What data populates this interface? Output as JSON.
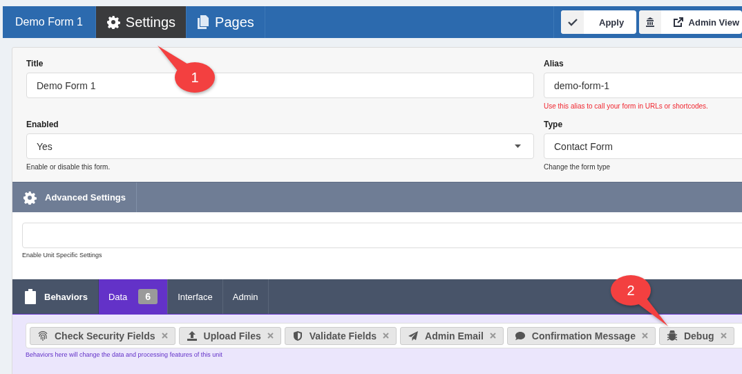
{
  "header": {
    "title": "Demo Form 1",
    "tabs": [
      {
        "label": "Settings",
        "selected": true
      },
      {
        "label": "Pages",
        "selected": false
      }
    ],
    "buttons": [
      {
        "label": "Apply"
      },
      {
        "label": "Admin View"
      }
    ]
  },
  "fields": [
    {
      "label": "Title",
      "kind": "text",
      "value": "Demo Form 1"
    },
    {
      "label": "Alias",
      "kind": "text",
      "value": "demo-form-1",
      "help": "Use this alias to call your form in URLs or shortcodes.",
      "help_error": true
    },
    {
      "label": "Enabled",
      "kind": "select",
      "value": "Yes",
      "help": "Enable or disable this form.",
      "help_error": false
    },
    {
      "label": "Type",
      "kind": "text",
      "value": "Contact Form",
      "help": "Change the form type",
      "help_error": false
    }
  ],
  "advanced": {
    "title": "Advanced Settings",
    "help": "Enable Unit Specific Settings"
  },
  "behaviors": {
    "title": "Behaviors",
    "tabs": [
      {
        "label": "Data",
        "badge": "6",
        "selected": true
      },
      {
        "label": "Interface",
        "selected": false
      },
      {
        "label": "Admin",
        "selected": false
      }
    ],
    "chips": [
      {
        "label": "Check Security Fields"
      },
      {
        "label": "Upload Files"
      },
      {
        "label": "Validate Fields"
      },
      {
        "label": "Admin Email"
      },
      {
        "label": "Confirmation Message"
      },
      {
        "label": "Debug"
      }
    ],
    "help": "Behaviors here will change the data and processing features of this unit"
  },
  "callouts": [
    {
      "text": "1"
    },
    {
      "text": "2"
    }
  ]
}
